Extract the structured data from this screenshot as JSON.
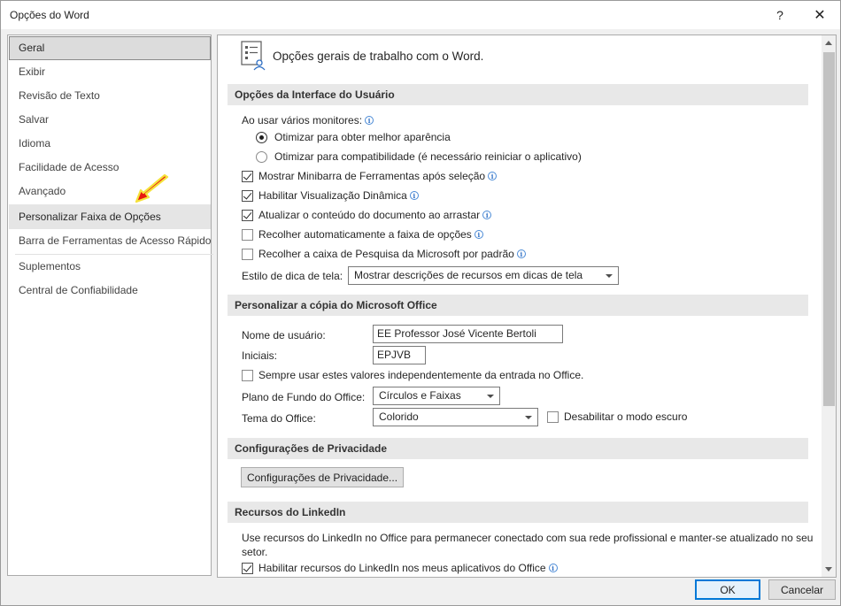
{
  "window": {
    "title": "Opções do Word",
    "help_label": "?",
    "close_label": "✕"
  },
  "nav": {
    "items": [
      {
        "label": "Geral"
      },
      {
        "label": "Exibir"
      },
      {
        "label": "Revisão de Texto"
      },
      {
        "label": "Salvar"
      },
      {
        "label": "Idioma"
      },
      {
        "label": "Facilidade de Acesso"
      },
      {
        "label": "Avançado"
      },
      {
        "label": "Personalizar Faixa de Opções"
      },
      {
        "label": "Barra de Ferramentas de Acesso Rápido"
      },
      {
        "label": "Suplementos"
      },
      {
        "label": "Central de Confiabilidade"
      }
    ],
    "selected": "Geral",
    "hovered": "Personalizar Faixa de Opções"
  },
  "content": {
    "header": "Opções gerais de trabalho com o Word.",
    "sections": {
      "ui": "Opções da Interface do Usuário",
      "personalize": "Personalizar a cópia do Microsoft Office",
      "privacy": "Configurações de Privacidade",
      "linkedin": "Recursos do LinkedIn"
    },
    "monitors_label": "Ao usar vários monitores:",
    "radio_best": "Otimizar para obter melhor aparência",
    "radio_compat": "Otimizar para compatibilidade (é necessário reiniciar o aplicativo)",
    "chk_minibar": "Mostrar Minibarra de Ferramentas após seleção",
    "chk_live_preview": "Habilitar Visualização Dinâmica",
    "chk_update_doc": "Atualizar o conteúdo do documento ao arrastar",
    "chk_collapse_ribbon": "Recolher automaticamente a faixa de opções",
    "chk_collapse_search": "Recolher a caixa de Pesquisa da Microsoft por padrão",
    "screentip_label": "Estilo de dica de tela:",
    "screentip_value": "Mostrar descrições de recursos em dicas de tela",
    "username_label": "Nome de usuário:",
    "username_value": "EE Professor José Vicente Bertoli",
    "initials_label": "Iniciais:",
    "initials_value": "EPJVB",
    "chk_always_use": "Sempre usar estes valores independentemente da entrada no Office.",
    "background_label": "Plano de Fundo do Office:",
    "background_value": "Círculos e Faixas",
    "theme_label": "Tema do Office:",
    "theme_value": "Colorido",
    "chk_dark_mode": "Desabilitar o modo escuro",
    "privacy_button": "Configurações de Privacidade...",
    "linkedin_text": "Use recursos do LinkedIn no Office para permanecer conectado com sua rede profissional e manter-se atualizado no seu setor.",
    "chk_linkedin": "Habilitar recursos do LinkedIn nos meus aplicativos do Office"
  },
  "footer": {
    "ok_label": "OK",
    "cancel_label": "Cancelar"
  },
  "colors": {
    "accent": "#0078d7",
    "arrow_fill": "#e8170f",
    "arrow_outline": "#f5e23a"
  },
  "icons": {
    "info": "info-icon",
    "header": "general-options-icon",
    "arrow": "red-pointer-arrow-icon"
  }
}
